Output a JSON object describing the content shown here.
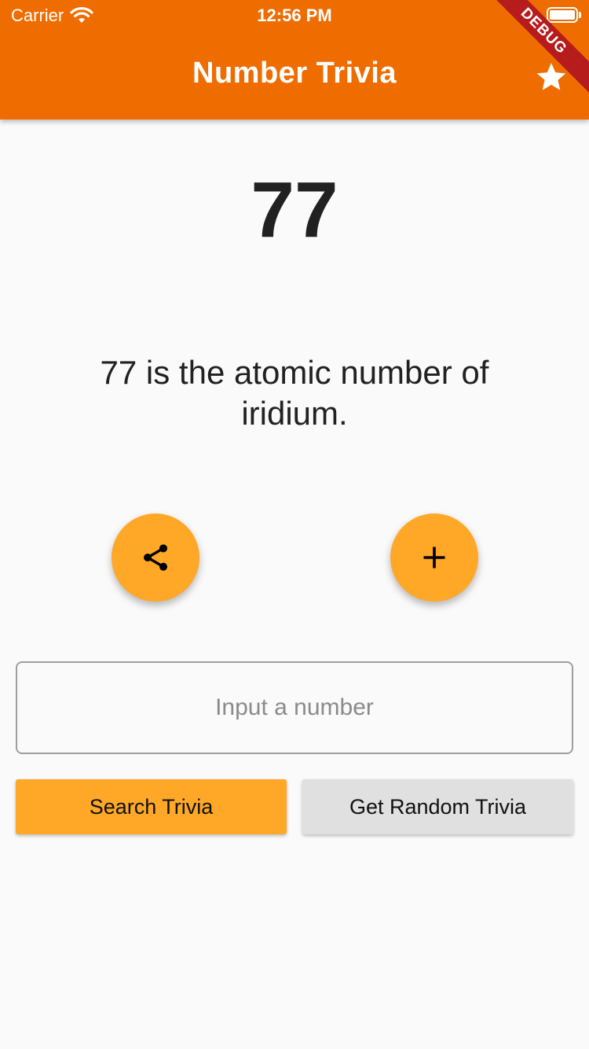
{
  "status_bar": {
    "carrier": "Carrier",
    "time": "12:56 PM"
  },
  "app_bar": {
    "title": "Number Trivia",
    "action_icon": "star-icon",
    "debug_banner": "DEBUG",
    "color": "#ef6c00"
  },
  "trivia": {
    "number": "77",
    "text": "77 is the atomic number of iridium."
  },
  "fabs": {
    "share_icon": "share-icon",
    "add_icon": "add-icon",
    "color": "#ffa726"
  },
  "input": {
    "placeholder": "Input a number",
    "value": ""
  },
  "buttons": {
    "search_label": "Search Trivia",
    "random_label": "Get Random Trivia"
  }
}
